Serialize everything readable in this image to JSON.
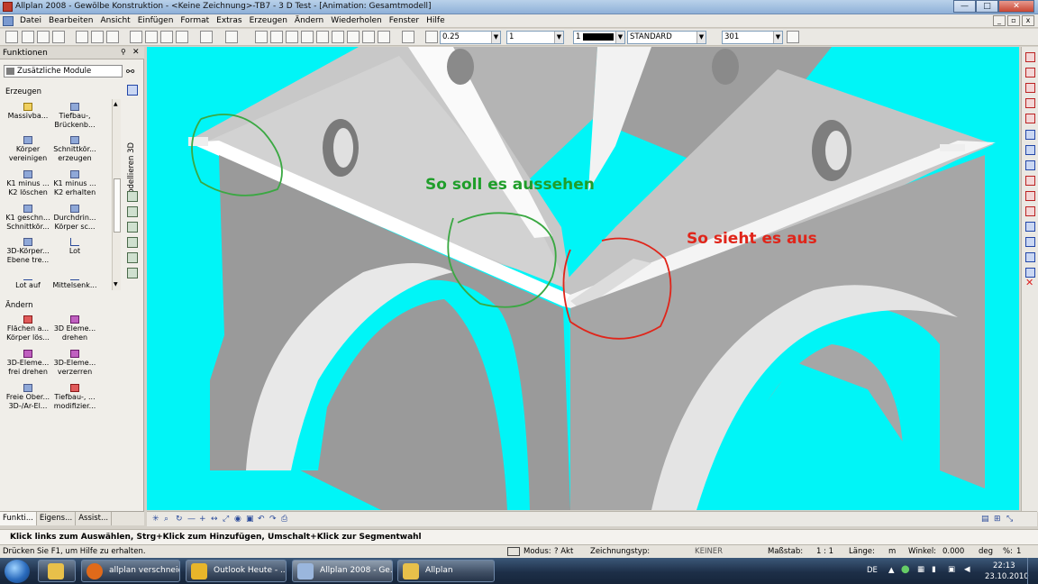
{
  "window": {
    "title": "Allplan 2008 - Gewölbe Konstruktion - <Keine Zeichnung>-TB7 - 3 D Test - [Animation: Gesamtmodell]",
    "minimize": "—",
    "maximize": "□",
    "close": "✕"
  },
  "menu": [
    "Datei",
    "Bearbeiten",
    "Ansicht",
    "Einfügen",
    "Format",
    "Extras",
    "Erzeugen",
    "Ändern",
    "Wiederholen",
    "Fenster",
    "Hilfe"
  ],
  "toolbar": {
    "pen_value": "0.25",
    "line_value": "1",
    "color_value": "1",
    "layer_value": "STANDARD",
    "hatch_value": "301"
  },
  "functions_panel": {
    "title": "Funktionen",
    "module": "Zusätzliche Module",
    "side_label": "Modellieren 3D",
    "group_create": "Erzeugen",
    "create_items": [
      [
        "Massivba...",
        "Tiefbau-, Brückenb..."
      ],
      [
        "Körper vereinigen",
        "Schnittkör... erzeugen"
      ],
      [
        "K1 minus ... K2 löschen",
        "K1 minus ... K2 erhalten"
      ],
      [
        "K1 geschn... Schnittkör...",
        "Durchdrin... Körper sc..."
      ],
      [
        "3D-Körper... Ebene tre...",
        "Lot"
      ],
      [
        "Lot auf",
        "Mittelsenk..."
      ]
    ],
    "group_modify": "Ändern",
    "modify_items": [
      [
        "Flächen a... Körper lös...",
        "3D Eleme... drehen"
      ],
      [
        "3D-Eleme... frei drehen",
        "3D-Eleme... verzerren"
      ],
      [
        "Freie Ober... 3D-/Ar-El...",
        "Tiefbau-, ... modifizier..."
      ]
    ],
    "tabs": [
      "Funkti...",
      "Eigens...",
      "Assist..."
    ]
  },
  "annotations": {
    "expected": "So soll es aussehen",
    "actual": "So sieht es aus"
  },
  "colors": {
    "viewport_bg": "#00f5f7",
    "expected": "#1f9e2a",
    "actual": "#e0251a"
  },
  "prompt": "Klick links zum Auswählen, Strg+Klick zum Hinzufügen, Umschalt+Klick zur Segmentwahl",
  "status": {
    "help": "Drücken Sie F1, um Hilfe zu erhalten.",
    "modus_label": "Modus:",
    "modus_value": "? Akt",
    "zeichnungstyp_label": "Zeichnungstyp:",
    "zeichnungstyp_value": "KEINER",
    "massstab_label": "Maßstab:",
    "massstab_value": "1 : 1",
    "laenge_label": "Länge:",
    "laenge_value": "m",
    "winkel_label": "Winkel:",
    "winkel_value": "0.000",
    "winkel_unit": "deg",
    "percent_label": "%:",
    "percent_value": "1"
  },
  "taskbar": {
    "buttons": [
      "allplan verschneid...",
      "Outlook Heute - ...",
      "Allplan 2008 - Ge...",
      "Allplan"
    ],
    "lang": "DE",
    "time": "22:13",
    "date": "23.10.2010"
  }
}
